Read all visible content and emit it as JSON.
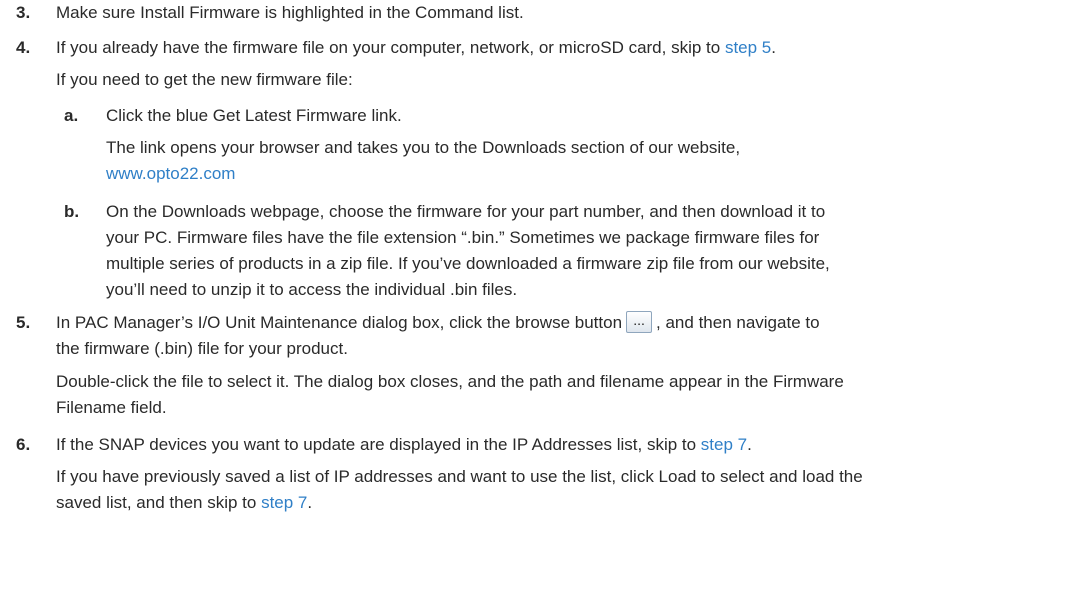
{
  "steps": {
    "s3": {
      "num": "3.",
      "text": "Make sure Install Firmware is highlighted in the Command list."
    },
    "s4": {
      "num": "4.",
      "text_pre": "If you already have the firmware file on your computer, network, or microSD card, skip to ",
      "link": "step 5",
      "text_post": ".",
      "para2": "If you need to get the new firmware file:",
      "a": {
        "letter": "a.",
        "line1": "Click the blue Get Latest Firmware link.",
        "line2": "The link opens your browser and takes you to the Downloads section of our website,",
        "link": "www.opto22.com"
      },
      "b": {
        "letter": "b.",
        "line1": "On the Downloads webpage, choose the firmware for your part number, and then download it to",
        "line2": "your PC. Firmware files have the file extension “.bin.” Sometimes we package firmware files for",
        "line3": "multiple series of products in a zip file. If you’ve downloaded a firmware zip file from our website,",
        "line4": "you’ll need to unzip it to access the individual .bin files."
      }
    },
    "s5": {
      "num": "5.",
      "line1_pre": "In PAC Manager’s I/O Unit Maintenance dialog box, click the browse button",
      "button_label": "...",
      "line1_post": ", and then navigate to",
      "line2": "the firmware (.bin) file for your product.",
      "line3": "Double-click the file to select it. The dialog box closes, and the path and filename appear in the Firmware",
      "line4": "Filename field."
    },
    "s6": {
      "num": "6.",
      "line1_pre": "If the SNAP devices you want to update are displayed in the IP Addresses list, skip to ",
      "line1_link": "step 7",
      "line1_post": ".",
      "line2": "If you have previously saved a list of IP addresses and want to use the list, click Load to select and load the",
      "line3_pre": "saved list, and then skip to ",
      "line3_link": "step 7",
      "line3_post": "."
    }
  }
}
